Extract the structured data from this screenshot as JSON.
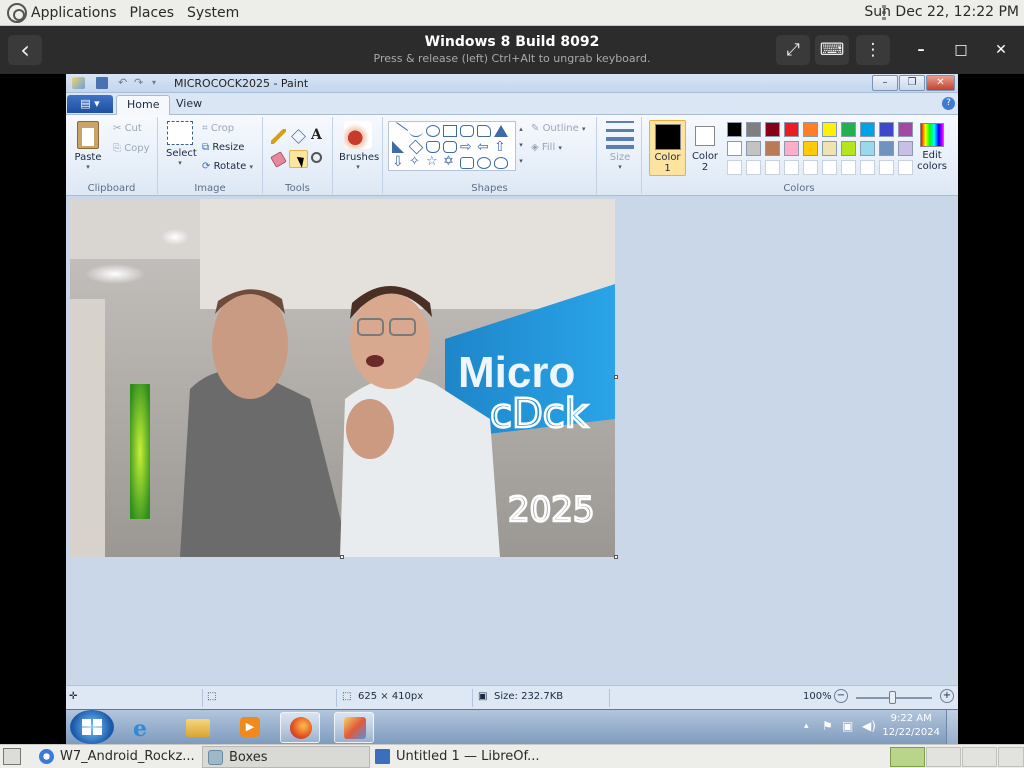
{
  "top_panel": {
    "menus": [
      "Applications",
      "Places",
      "System"
    ],
    "clock": "Sun Dec 22, 12:22 PM"
  },
  "boxes": {
    "title": "Windows 8 Build 8092",
    "subtitle": "Press & release (left) Ctrl+Alt to ungrab keyboard.",
    "back_icon": "‹",
    "fullscreen_icon": "⤢",
    "keyboard_icon": "⌨",
    "menu_icon": "⋮",
    "minimize": "–",
    "maximize": "□",
    "close": "✕"
  },
  "paint": {
    "window_title": "MICROCOCK2025 - Paint",
    "tabs": [
      "Home",
      "View"
    ],
    "file_button": "▤ ▾",
    "clipboard": {
      "paste": "Paste",
      "cut": "Cut",
      "copy": "Copy",
      "label": "Clipboard"
    },
    "image": {
      "select": "Select",
      "crop": "Crop",
      "resize": "Resize",
      "rotate": "Rotate",
      "label": "Image"
    },
    "tools": {
      "label": "Tools",
      "text_tool": "A"
    },
    "brushes": {
      "label": "Brushes"
    },
    "shapes": {
      "outline": "Outline",
      "fill": "Fill",
      "label": "Shapes"
    },
    "size": {
      "label": "Size"
    },
    "colors": {
      "color1": "Color\n1",
      "color1_line1": "Color",
      "color1_line2": "1",
      "color2_line1": "Color",
      "color2_line2": "2",
      "edit_line1": "Edit",
      "edit_line2": "colors",
      "label": "Colors",
      "color1_value": "#000000",
      "color2_value": "#ffffff",
      "palette_row1": [
        "#000000",
        "#7f7f7f",
        "#880015",
        "#ed1c24",
        "#ff7f27",
        "#fff200",
        "#22b14c",
        "#00a2e8",
        "#3f48cc",
        "#a349a4"
      ],
      "palette_row2": [
        "#ffffff",
        "#c3c3c3",
        "#b97a57",
        "#ffaec9",
        "#ffc90e",
        "#efe4b0",
        "#b5e61d",
        "#99d9ea",
        "#7092be",
        "#c8bfe7"
      ]
    },
    "canvas_text": {
      "logo": "Micro",
      "scribble1": "cDck",
      "scribble2": "2025"
    },
    "status": {
      "dimensions": "625 × 410px",
      "size": "Size: 232.7KB",
      "zoom": "100%"
    }
  },
  "win_taskbar": {
    "time": "9:22 AM",
    "date": "12/22/2024"
  },
  "bottom_panel": {
    "windows": [
      "W7_Android_Rockz...",
      "Boxes",
      "Untitled 1 — LibreOf..."
    ]
  }
}
